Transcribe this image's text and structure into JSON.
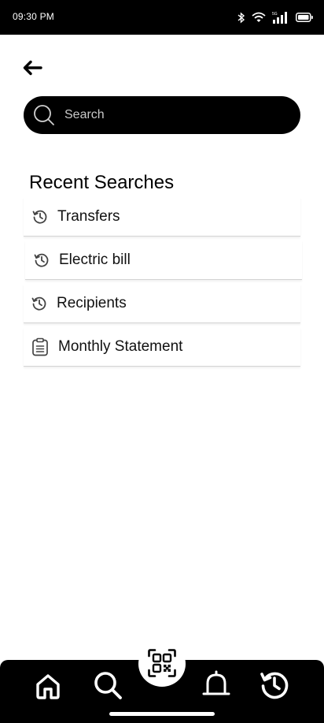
{
  "status_bar": {
    "time": "09:30 PM",
    "icons": [
      "bluetooth-icon",
      "wifi-icon",
      "signal-5g-icon",
      "battery-icon"
    ]
  },
  "search": {
    "placeholder": "Search",
    "value": ""
  },
  "recent": {
    "title": "Recent Searches",
    "items": [
      {
        "label": "Transfers",
        "icon": "history-icon"
      },
      {
        "label": "Electric bill",
        "icon": "history-icon"
      },
      {
        "label": "Recipients",
        "icon": "history-icon"
      },
      {
        "label": "Monthly Statement",
        "icon": "clipboard-icon"
      }
    ]
  },
  "bottom_nav": {
    "items": [
      "home-icon",
      "search-icon",
      "qr-code-icon",
      "bell-icon",
      "history-icon"
    ]
  },
  "colors": {
    "background": "#ffffff",
    "bar": "#000000",
    "divider": "#d4d4d4"
  }
}
